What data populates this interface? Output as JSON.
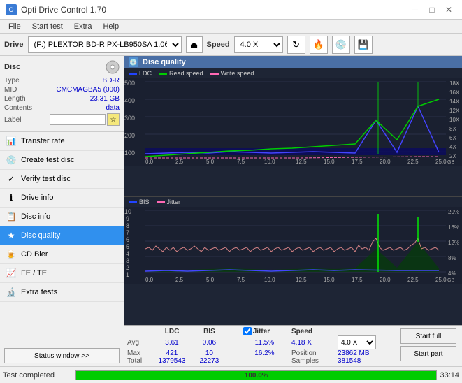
{
  "titlebar": {
    "title": "Opti Drive Control 1.70",
    "icon": "O",
    "min_btn": "─",
    "max_btn": "□",
    "close_btn": "✕"
  },
  "menubar": {
    "items": [
      "File",
      "Start test",
      "Extra",
      "Help"
    ]
  },
  "drivebar": {
    "label": "Drive",
    "drive_value": "(F:)  PLEXTOR BD-R  PX-LB950SA 1.06",
    "speed_label": "Speed",
    "speed_value": "4.0 X"
  },
  "disc": {
    "header": "Disc",
    "type_label": "Type",
    "type_value": "BD-R",
    "mid_label": "MID",
    "mid_value": "CMCMAGBA5 (000)",
    "length_label": "Length",
    "length_value": "23.31 GB",
    "contents_label": "Contents",
    "contents_value": "data",
    "label_label": "Label",
    "label_value": ""
  },
  "nav": {
    "items": [
      {
        "id": "transfer-rate",
        "label": "Transfer rate",
        "icon": "📊"
      },
      {
        "id": "create-test-disc",
        "label": "Create test disc",
        "icon": "💿"
      },
      {
        "id": "verify-test-disc",
        "label": "Verify test disc",
        "icon": "✓"
      },
      {
        "id": "drive-info",
        "label": "Drive info",
        "icon": "ℹ"
      },
      {
        "id": "disc-info",
        "label": "Disc info",
        "icon": "📋"
      },
      {
        "id": "disc-quality",
        "label": "Disc quality",
        "icon": "★",
        "active": true
      },
      {
        "id": "cd-bier",
        "label": "CD Bier",
        "icon": "🍺"
      },
      {
        "id": "fe-te",
        "label": "FE / TE",
        "icon": "📈"
      },
      {
        "id": "extra-tests",
        "label": "Extra tests",
        "icon": "🔬"
      }
    ],
    "status_btn": "Status window >>"
  },
  "chart1": {
    "title": "Disc quality",
    "icon": "💿",
    "legend": [
      {
        "label": "LDC",
        "color": "#0000ff"
      },
      {
        "label": "Read speed",
        "color": "#00ff00"
      },
      {
        "label": "Write speed",
        "color": "#ff69b4"
      }
    ],
    "y_max": 500,
    "y_right_max": 18,
    "x_max": 25,
    "right_labels": [
      "18X",
      "16X",
      "14X",
      "12X",
      "10X",
      "8X",
      "6X",
      "4X",
      "2X"
    ]
  },
  "chart2": {
    "legend": [
      {
        "label": "BIS",
        "color": "#0000ff"
      },
      {
        "label": "Jitter",
        "color": "#ff69b4"
      }
    ],
    "y_max": 10,
    "y_right_max": 20,
    "x_max": 25,
    "right_labels": [
      "20%",
      "16%",
      "12%",
      "8%",
      "4%"
    ]
  },
  "stats": {
    "col_headers": [
      "LDC",
      "BIS",
      "",
      "Jitter",
      "Speed",
      ""
    ],
    "avg_label": "Avg",
    "avg_ldc": "3.61",
    "avg_bis": "0.06",
    "avg_jitter": "11.5%",
    "max_label": "Max",
    "max_ldc": "421",
    "max_bis": "10",
    "max_jitter": "16.2%",
    "total_label": "Total",
    "total_ldc": "1379543",
    "total_bis": "22273",
    "speed_label": "Speed",
    "speed_value": "4.18 X",
    "speed_select": "4.0 X",
    "position_label": "Position",
    "position_value": "23862 MB",
    "samples_label": "Samples",
    "samples_value": "381548",
    "jitter_checked": true,
    "jitter_label": "Jitter",
    "start_full_btn": "Start full",
    "start_part_btn": "Start part"
  },
  "bottombar": {
    "status_text": "Test completed",
    "progress": 100,
    "progress_text": "100.0%",
    "time": "33:14"
  }
}
